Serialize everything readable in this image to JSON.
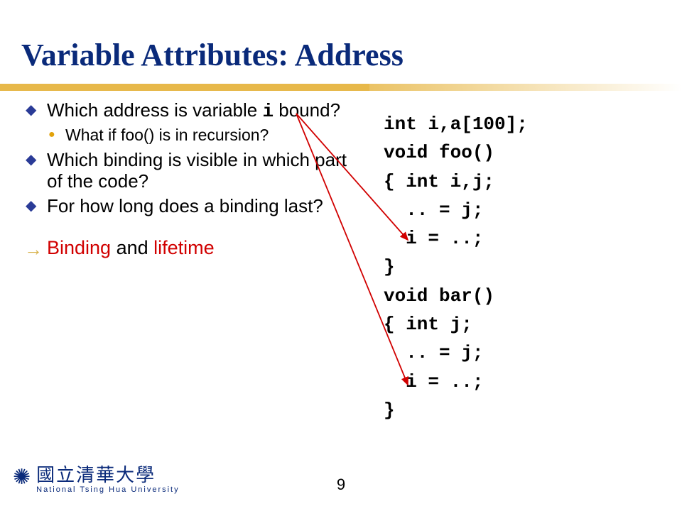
{
  "title": "Variable Attributes: Address",
  "bullets": {
    "b1a": "Which address is variable ",
    "b1b": "i",
    "b1c": " bound?",
    "b1_1": "What if foo() is in recursion?",
    "b2": "Which binding is visible in which part of the code?",
    "b3": "For how long does a binding last?",
    "b4a": "Binding",
    "b4b": " and ",
    "b4c": "lifetime"
  },
  "code": {
    "l1": "int i,a[100];",
    "l2": "void foo()",
    "l3": "{ int i,j;",
    "l4": "  .. = j;",
    "l5": "  i = ..;",
    "l6": "}",
    "l7": "void bar()",
    "l8": "{ int j;",
    "l9": "  .. = j;",
    "l10": "  i = ..;",
    "l11": "}"
  },
  "footer": {
    "uni_zh": "國立清華大學",
    "uni_en": "National Tsing Hua University",
    "page": "9"
  }
}
